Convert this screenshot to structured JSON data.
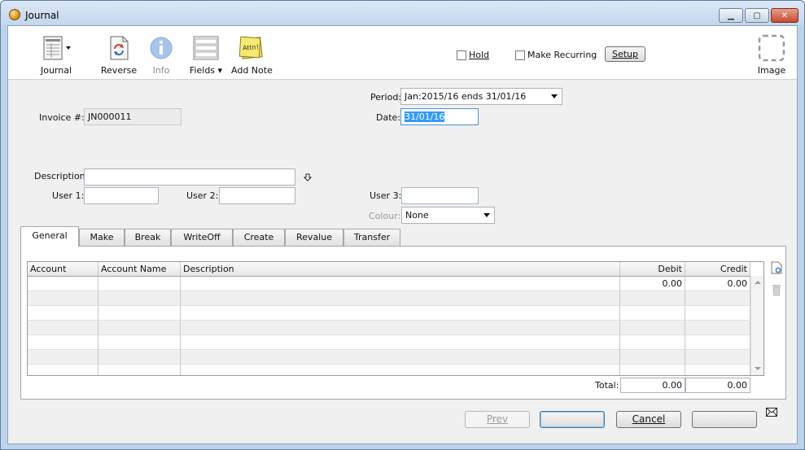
{
  "window": {
    "title": "Journal",
    "minimize": "▁",
    "maximize": "▢",
    "close": "✕"
  },
  "toolbar": {
    "journal": "Journal",
    "reverse": "Reverse",
    "info": "Info",
    "fields": "Fields",
    "add_note": "Add Note",
    "note_text": "Attn!",
    "hold": "Hold",
    "make_recurring": "Make Recurring",
    "setup": "Setup",
    "image": "Image"
  },
  "form": {
    "invoice_label": "Invoice #:",
    "invoice_value": "JN000011",
    "period_label": "Period:",
    "period_value": "Jan:2015/16 ends 31/01/16",
    "date_label": "Date:",
    "date_value": "31/01/16",
    "description_label": "Description:",
    "description_value": "",
    "user1_label": "User 1:",
    "user1_value": "",
    "user2_label": "User 2:",
    "user2_value": "",
    "user3_label": "User 3:",
    "user3_value": "",
    "colour_label": "Colour:",
    "colour_value": "None"
  },
  "tabs": [
    "General",
    "Make",
    "Break",
    "WriteOff",
    "Create",
    "Revalue",
    "Transfer"
  ],
  "grid": {
    "columns": [
      "Account",
      "Account Name",
      "Description",
      "Debit",
      "Credit"
    ],
    "rows": [
      [
        "",
        "",
        "",
        "0.00",
        "0.00"
      ]
    ]
  },
  "totals": {
    "label": "Total:",
    "debit": "0.00",
    "credit": "0.00"
  },
  "buttons": {
    "prev": "Prev",
    "next": "",
    "cancel": "Cancel",
    "save": ""
  }
}
